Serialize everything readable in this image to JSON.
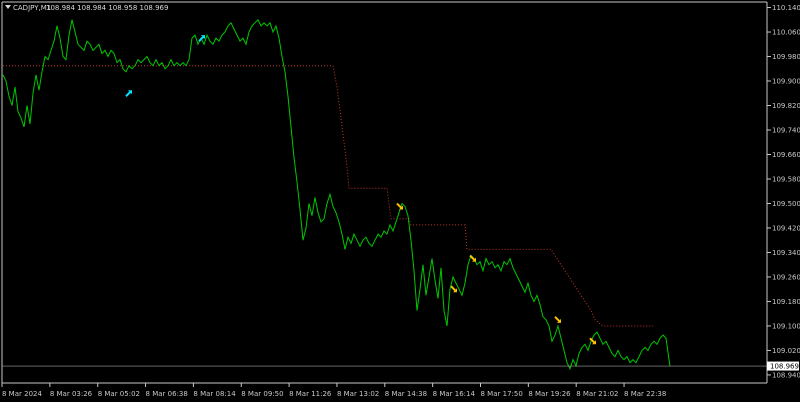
{
  "header": {
    "symbol_timeframe": "CADJPY,M1",
    "ohlc": "108.984 108.984 108.958 108.969"
  },
  "colors": {
    "background": "#000000",
    "price_line": "#00c800",
    "stop_line": "#c0392b",
    "buy_arrow": "#00e5ff",
    "sell_arrow": "#ffc000",
    "axis": "#c8c8c8",
    "current_price_line": "#a0a0a0"
  },
  "chart_data": {
    "type": "line",
    "ylim": [
      108.93,
      110.145
    ],
    "x_labels": [
      "8 Mar 2024",
      "8 Mar 03:26",
      "8 Mar 05:02",
      "8 Mar 06:38",
      "8 Mar 08:14",
      "8 Mar 09:50",
      "8 Mar 11:26",
      "8 Mar 13:02",
      "8 Mar 14:38",
      "8 Mar 16:14",
      "8 Mar 17:50",
      "8 Mar 19:26",
      "8 Mar 21:02",
      "8 Mar 22:38"
    ],
    "y_ticks": [
      "110.140",
      "110.060",
      "109.980",
      "109.900",
      "109.820",
      "109.740",
      "109.660",
      "109.580",
      "109.500",
      "109.420",
      "109.340",
      "109.260",
      "109.180",
      "109.100",
      "109.020",
      "108.940"
    ],
    "current_price": "108.969",
    "price_series": [
      [
        0,
        109.92
      ],
      [
        3,
        109.9
      ],
      [
        6,
        109.85
      ],
      [
        9,
        109.82
      ],
      [
        12,
        109.88
      ],
      [
        15,
        109.8
      ],
      [
        18,
        109.78
      ],
      [
        21,
        109.75
      ],
      [
        24,
        109.82
      ],
      [
        27,
        109.76
      ],
      [
        30,
        109.86
      ],
      [
        33,
        109.92
      ],
      [
        36,
        109.87
      ],
      [
        39,
        109.93
      ],
      [
        42,
        109.98
      ],
      [
        45,
        109.97
      ],
      [
        48,
        110.0
      ],
      [
        51,
        110.03
      ],
      [
        54,
        110.08
      ],
      [
        57,
        110.04
      ],
      [
        60,
        109.98
      ],
      [
        63,
        109.97
      ],
      [
        66,
        110.05
      ],
      [
        69,
        110.1
      ],
      [
        72,
        110.06
      ],
      [
        75,
        110.02
      ],
      [
        78,
        110.01
      ],
      [
        81,
        110.0
      ],
      [
        84,
        110.03
      ],
      [
        87,
        110.02
      ],
      [
        90,
        110.0
      ],
      [
        93,
        110.01
      ],
      [
        96,
        110.02
      ],
      [
        99,
        109.99
      ],
      [
        102,
        110.0
      ],
      [
        105,
        109.98
      ],
      [
        108,
        110.0
      ],
      [
        111,
        109.99
      ],
      [
        114,
        109.96
      ],
      [
        117,
        109.97
      ],
      [
        120,
        109.94
      ],
      [
        123,
        109.93
      ],
      [
        126,
        109.95
      ],
      [
        129,
        109.94
      ],
      [
        132,
        109.95
      ],
      [
        135,
        109.97
      ],
      [
        138,
        109.96
      ],
      [
        141,
        109.97
      ],
      [
        144,
        109.98
      ],
      [
        147,
        109.96
      ],
      [
        150,
        109.95
      ],
      [
        153,
        109.97
      ],
      [
        156,
        109.95
      ],
      [
        159,
        109.96
      ],
      [
        162,
        109.94
      ],
      [
        165,
        109.95
      ],
      [
        168,
        109.97
      ],
      [
        171,
        109.95
      ],
      [
        174,
        109.96
      ],
      [
        177,
        109.95
      ],
      [
        180,
        109.96
      ],
      [
        183,
        109.95
      ],
      [
        186,
        109.97
      ],
      [
        189,
        110.04
      ],
      [
        192,
        110.05
      ],
      [
        195,
        110.02
      ],
      [
        198,
        110.04
      ],
      [
        201,
        110.02
      ],
      [
        204,
        110.05
      ],
      [
        207,
        110.03
      ],
      [
        210,
        110.02
      ],
      [
        213,
        110.04
      ],
      [
        216,
        110.03
      ],
      [
        219,
        110.05
      ],
      [
        222,
        110.06
      ],
      [
        225,
        110.08
      ],
      [
        228,
        110.09
      ],
      [
        231,
        110.07
      ],
      [
        234,
        110.05
      ],
      [
        237,
        110.03
      ],
      [
        240,
        110.04
      ],
      [
        243,
        110.02
      ],
      [
        246,
        110.06
      ],
      [
        249,
        110.08
      ],
      [
        252,
        110.09
      ],
      [
        255,
        110.1
      ],
      [
        258,
        110.08
      ],
      [
        261,
        110.09
      ],
      [
        264,
        110.08
      ],
      [
        267,
        110.09
      ],
      [
        270,
        110.06
      ],
      [
        273,
        110.08
      ],
      [
        276,
        110.04
      ],
      [
        279,
        109.98
      ],
      [
        282,
        109.93
      ],
      [
        285,
        109.85
      ],
      [
        288,
        109.75
      ],
      [
        291,
        109.65
      ],
      [
        294,
        109.57
      ],
      [
        297,
        109.48
      ],
      [
        300,
        109.38
      ],
      [
        303,
        109.42
      ],
      [
        306,
        109.5
      ],
      [
        309,
        109.46
      ],
      [
        312,
        109.52
      ],
      [
        315,
        109.47
      ],
      [
        318,
        109.44
      ],
      [
        321,
        109.45
      ],
      [
        324,
        109.5
      ],
      [
        327,
        109.53
      ],
      [
        330,
        109.49
      ],
      [
        333,
        109.47
      ],
      [
        336,
        109.44
      ],
      [
        339,
        109.4
      ],
      [
        342,
        109.35
      ],
      [
        345,
        109.39
      ],
      [
        348,
        109.37
      ],
      [
        351,
        109.4
      ],
      [
        354,
        109.38
      ],
      [
        357,
        109.36
      ],
      [
        360,
        109.38
      ],
      [
        363,
        109.39
      ],
      [
        366,
        109.37
      ],
      [
        369,
        109.36
      ],
      [
        372,
        109.38
      ],
      [
        375,
        109.4
      ],
      [
        378,
        109.39
      ],
      [
        381,
        109.41
      ],
      [
        384,
        109.4
      ],
      [
        387,
        109.43
      ],
      [
        390,
        109.41
      ],
      [
        393,
        109.44
      ],
      [
        396,
        109.47
      ],
      [
        399,
        109.5
      ],
      [
        402,
        109.49
      ],
      [
        405,
        109.46
      ],
      [
        408,
        109.38
      ],
      [
        411,
        109.28
      ],
      [
        414,
        109.15
      ],
      [
        417,
        109.22
      ],
      [
        420,
        109.3
      ],
      [
        423,
        109.2
      ],
      [
        426,
        109.26
      ],
      [
        429,
        109.32
      ],
      [
        432,
        109.25
      ],
      [
        435,
        109.19
      ],
      [
        438,
        109.29
      ],
      [
        441,
        109.15
      ],
      [
        444,
        109.1
      ],
      [
        447,
        109.22
      ],
      [
        450,
        109.26
      ],
      [
        453,
        109.24
      ],
      [
        456,
        109.22
      ],
      [
        459,
        109.2
      ],
      [
        462,
        109.24
      ],
      [
        465,
        109.3
      ],
      [
        468,
        109.33
      ],
      [
        471,
        109.32
      ],
      [
        474,
        109.3
      ],
      [
        477,
        109.31
      ],
      [
        480,
        109.28
      ],
      [
        483,
        109.32
      ],
      [
        486,
        109.3
      ],
      [
        489,
        109.31
      ],
      [
        492,
        109.29
      ],
      [
        495,
        109.3
      ],
      [
        498,
        109.28
      ],
      [
        501,
        109.31
      ],
      [
        504,
        109.3
      ],
      [
        507,
        109.32
      ],
      [
        510,
        109.29
      ],
      [
        513,
        109.27
      ],
      [
        516,
        109.25
      ],
      [
        519,
        109.23
      ],
      [
        522,
        109.21
      ],
      [
        525,
        109.24
      ],
      [
        528,
        109.2
      ],
      [
        531,
        109.18
      ],
      [
        534,
        109.2
      ],
      [
        537,
        109.17
      ],
      [
        540,
        109.13
      ],
      [
        543,
        109.12
      ],
      [
        546,
        109.1
      ],
      [
        549,
        109.05
      ],
      [
        552,
        109.07
      ],
      [
        555,
        109.1
      ],
      [
        558,
        109.06
      ],
      [
        561,
        109.02
      ],
      [
        564,
        108.98
      ],
      [
        567,
        108.96
      ],
      [
        570,
        108.99
      ],
      [
        573,
        108.97
      ],
      [
        576,
        109.01
      ],
      [
        579,
        109.03
      ],
      [
        582,
        109.04
      ],
      [
        585,
        109.02
      ],
      [
        588,
        109.05
      ],
      [
        591,
        109.07
      ],
      [
        594,
        109.08
      ],
      [
        597,
        109.06
      ],
      [
        600,
        109.04
      ],
      [
        603,
        109.05
      ],
      [
        606,
        109.03
      ],
      [
        609,
        109.01
      ],
      [
        612,
        109.0
      ],
      [
        615,
        109.02
      ],
      [
        618,
        109.0
      ],
      [
        621,
        108.99
      ],
      [
        624,
        109.0
      ],
      [
        627,
        108.98
      ],
      [
        630,
        108.99
      ],
      [
        633,
        108.98
      ],
      [
        636,
        109.0
      ],
      [
        639,
        109.02
      ],
      [
        642,
        109.03
      ],
      [
        645,
        109.02
      ],
      [
        648,
        109.04
      ],
      [
        651,
        109.05
      ],
      [
        654,
        109.04
      ],
      [
        657,
        109.06
      ],
      [
        660,
        109.07
      ],
      [
        663,
        109.06
      ],
      [
        666,
        108.99
      ],
      [
        667,
        108.969
      ]
    ],
    "stop_series": [
      [
        0,
        109.95
      ],
      [
        330,
        109.95
      ],
      [
        334,
        109.88
      ],
      [
        338,
        109.78
      ],
      [
        341,
        109.7
      ],
      [
        344,
        109.62
      ],
      [
        346,
        109.55
      ],
      [
        384,
        109.55
      ],
      [
        388,
        109.45
      ],
      [
        406,
        109.45
      ],
      [
        408,
        109.43
      ],
      [
        462,
        109.43
      ],
      [
        464,
        109.35
      ],
      [
        548,
        109.35
      ],
      [
        552,
        109.33
      ],
      [
        556,
        109.31
      ],
      [
        560,
        109.29
      ],
      [
        564,
        109.27
      ],
      [
        568,
        109.25
      ],
      [
        572,
        109.23
      ],
      [
        576,
        109.21
      ],
      [
        580,
        109.19
      ],
      [
        584,
        109.17
      ],
      [
        588,
        109.15
      ],
      [
        592,
        109.12
      ],
      [
        596,
        109.11
      ],
      [
        600,
        109.1
      ],
      [
        650,
        109.1
      ]
    ],
    "buy_signals": [
      [
        126,
        109.86
      ],
      [
        199,
        110.04
      ]
    ],
    "sell_signals": [
      [
        397,
        109.49
      ],
      [
        451,
        109.22
      ],
      [
        470,
        109.32
      ],
      [
        555,
        109.12
      ],
      [
        590,
        109.05
      ]
    ]
  }
}
